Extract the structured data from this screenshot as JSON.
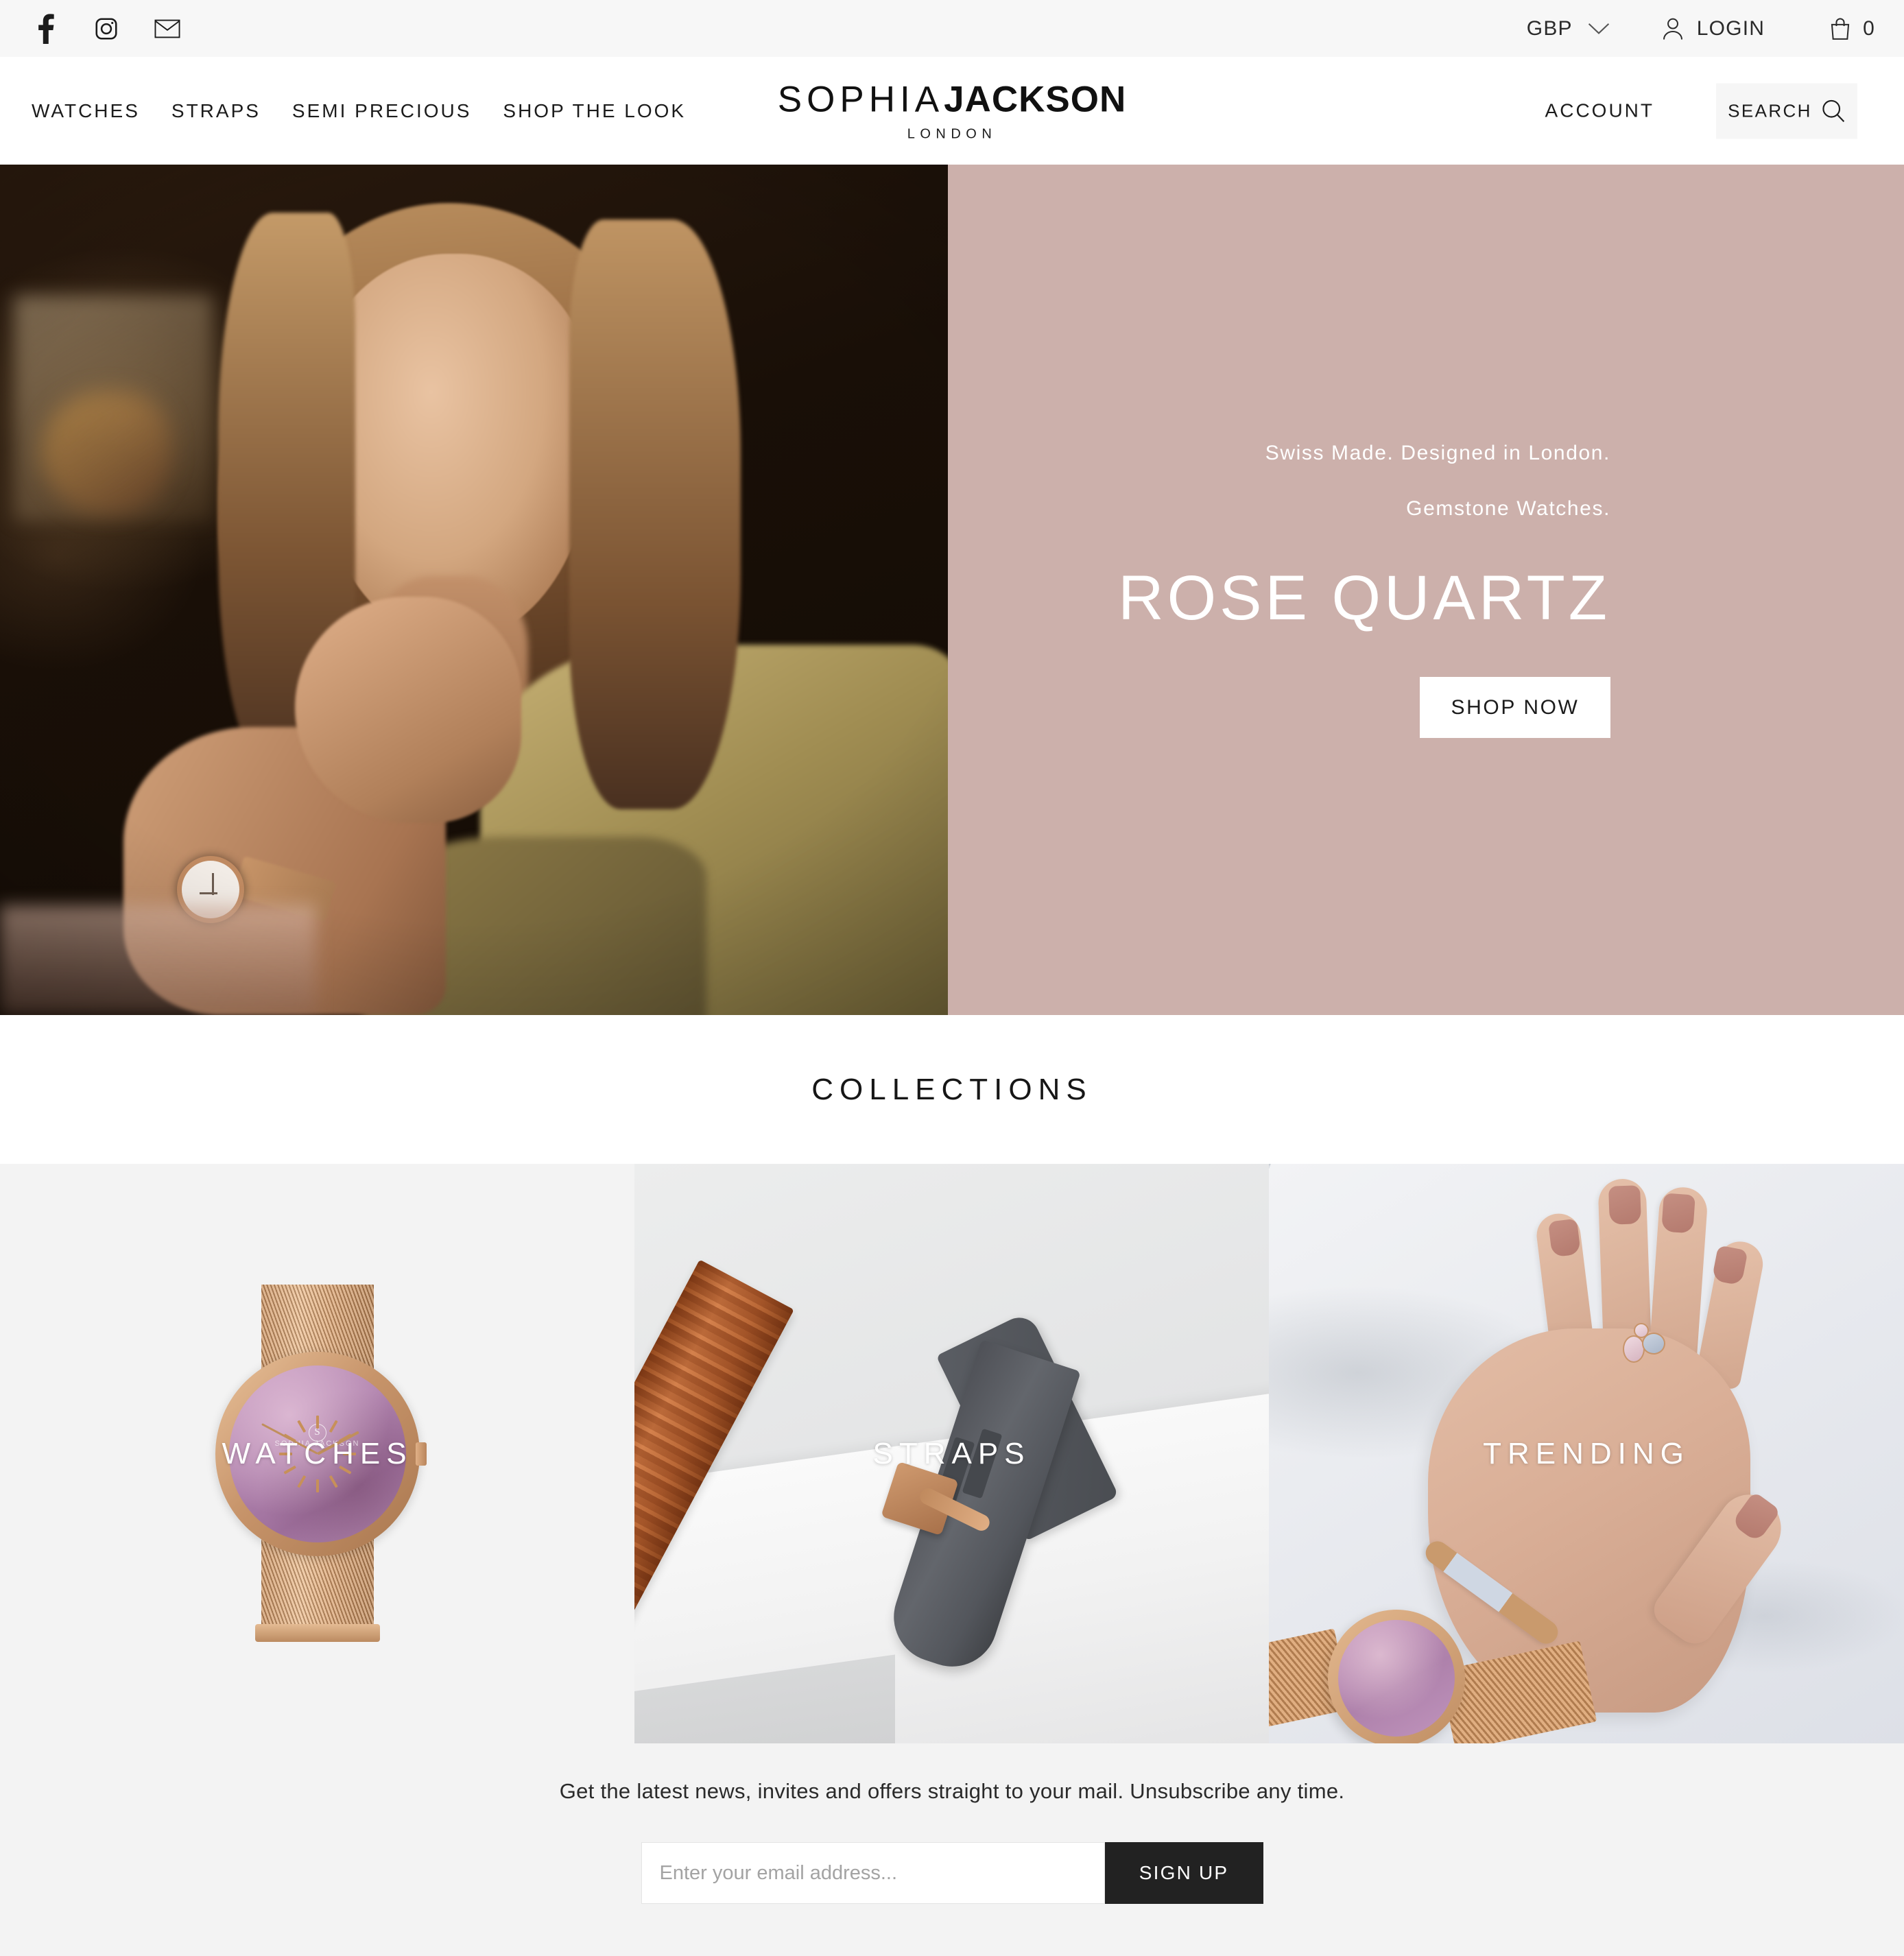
{
  "topbar": {
    "social": [
      {
        "name": "facebook-icon",
        "label": "Facebook"
      },
      {
        "name": "instagram-icon",
        "label": "Instagram"
      },
      {
        "name": "email-icon",
        "label": "Email"
      }
    ],
    "currency": "GBP",
    "login_label": "LOGIN",
    "cart_count": "0"
  },
  "nav": {
    "items": [
      {
        "label": "WATCHES"
      },
      {
        "label": "STRAPS"
      },
      {
        "label": "SEMI PRECIOUS"
      },
      {
        "label": "SHOP THE LOOK"
      }
    ],
    "account_label": "ACCOUNT",
    "search_label": "SEARCH"
  },
  "logo": {
    "part_thin": "SOPHIA",
    "part_bold": "JACKSON",
    "sub": "LONDON"
  },
  "hero": {
    "tagline_1": "Swiss Made. Designed in London.",
    "tagline_2": "Gemstone Watches.",
    "title": "ROSE QUARTZ",
    "cta_label": "SHOP NOW",
    "panel_color": "#ccb0ab",
    "watch_dial_brand": "SOPHIA JACKSON"
  },
  "collections": {
    "heading": "COLLECTIONS",
    "tiles": [
      {
        "label": "WATCHES"
      },
      {
        "label": "STRAPS"
      },
      {
        "label": "TRENDING"
      }
    ]
  },
  "newsletter": {
    "text": "Get the latest news, invites and offers straight to your mail. Unsubscribe any time.",
    "placeholder": "Enter your email address...",
    "button_label": "SIGN UP",
    "input_value": ""
  },
  "watch_dial": {
    "brand_mark": "S",
    "brand_text": "SOPHIA JACKSON"
  }
}
